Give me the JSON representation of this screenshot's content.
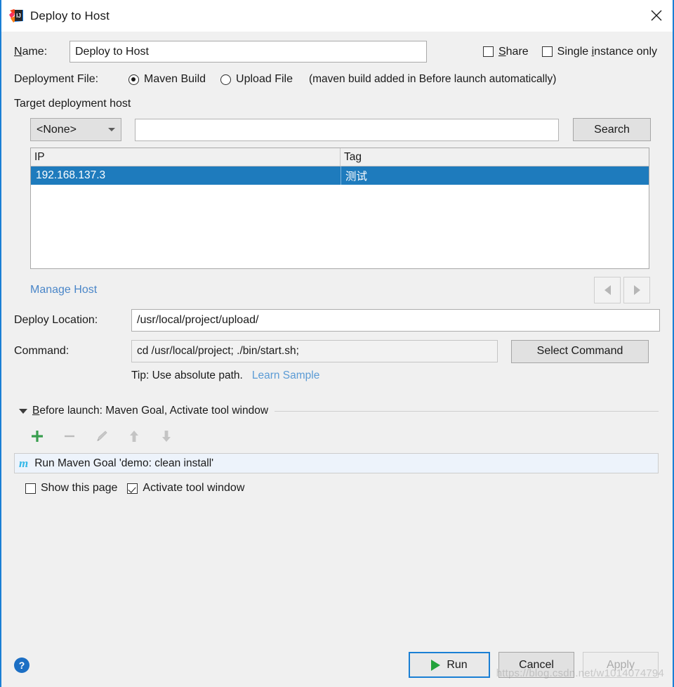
{
  "window": {
    "title": "Deploy to Host",
    "app_icon": "intellij-idea-logo",
    "close_icon": "close-icon",
    "accent_color": "#1a7fd4"
  },
  "form": {
    "name_label": "Name:",
    "name_value": "Deploy to Host",
    "share_label": "Share",
    "share_checked": false,
    "single_instance_label": "Single instance only",
    "single_instance_checked": false,
    "deployment_file_label": "Deployment File:",
    "radio_maven_label": "Maven Build",
    "radio_upload_label": "Upload File",
    "radio_selected": "Maven Build",
    "maven_note": "(maven build added in Before launch automatically)"
  },
  "target_host": {
    "section_title": "Target deployment host",
    "select_value": "<None>",
    "select_chevron_icon": "chevron-down-icon",
    "search_value": "",
    "search_placeholder": "",
    "search_button_label": "Search",
    "columns": [
      "IP",
      "Tag"
    ],
    "rows": [
      {
        "ip": "192.168.137.3",
        "tag": "测试",
        "selected": true
      }
    ],
    "selection_color": "#1e7bbd",
    "manage_host_link": "Manage Host",
    "manage_host_link_color": "#4a86c8",
    "pager_prev_icon": "triangle-left-icon",
    "pager_next_icon": "triangle-right-icon"
  },
  "deploy": {
    "location_label": "Deploy Location:",
    "location_value": "/usr/local/project/upload/",
    "command_label": "Command:",
    "command_value": "cd /usr/local/project; ./bin/start.sh;",
    "select_command_label": "Select Command",
    "tip_text": "Tip: Use absolute path.",
    "learn_sample_link": "Learn Sample",
    "learn_sample_color": "#5b9bd5"
  },
  "before_launch": {
    "expand_icon": "triangle-down-icon",
    "title": "Before launch: Maven Goal, Activate tool window",
    "toolbar": [
      {
        "name": "add-icon",
        "glyph": "+",
        "enabled": true,
        "color": "#389e4e"
      },
      {
        "name": "remove-icon",
        "glyph": "−",
        "enabled": false,
        "color": "#b8b8b8"
      },
      {
        "name": "edit-pencil-icon",
        "glyph": "✎",
        "enabled": false,
        "color": "#b8b8b8"
      },
      {
        "name": "arrow-up-icon",
        "glyph": "↑",
        "enabled": false,
        "color": "#bcbcbc"
      },
      {
        "name": "arrow-down-icon",
        "glyph": "↓",
        "enabled": false,
        "color": "#bcbcbc"
      }
    ],
    "items": [
      {
        "icon": "maven-icon",
        "icon_glyph": "m",
        "icon_color": "#35b8e8",
        "text": "Run Maven Goal 'demo: clean install'"
      }
    ],
    "show_page_label": "Show this page",
    "show_page_checked": false,
    "activate_tool_window_label": "Activate tool window",
    "activate_tool_window_checked": true
  },
  "footer": {
    "help_icon": "help-icon",
    "help_glyph": "?",
    "run_label": "Run",
    "run_icon": "play-icon",
    "cancel_label": "Cancel",
    "apply_label": "Apply",
    "apply_enabled": false
  },
  "watermark": "https://blog.csdn.net/w1014074794"
}
